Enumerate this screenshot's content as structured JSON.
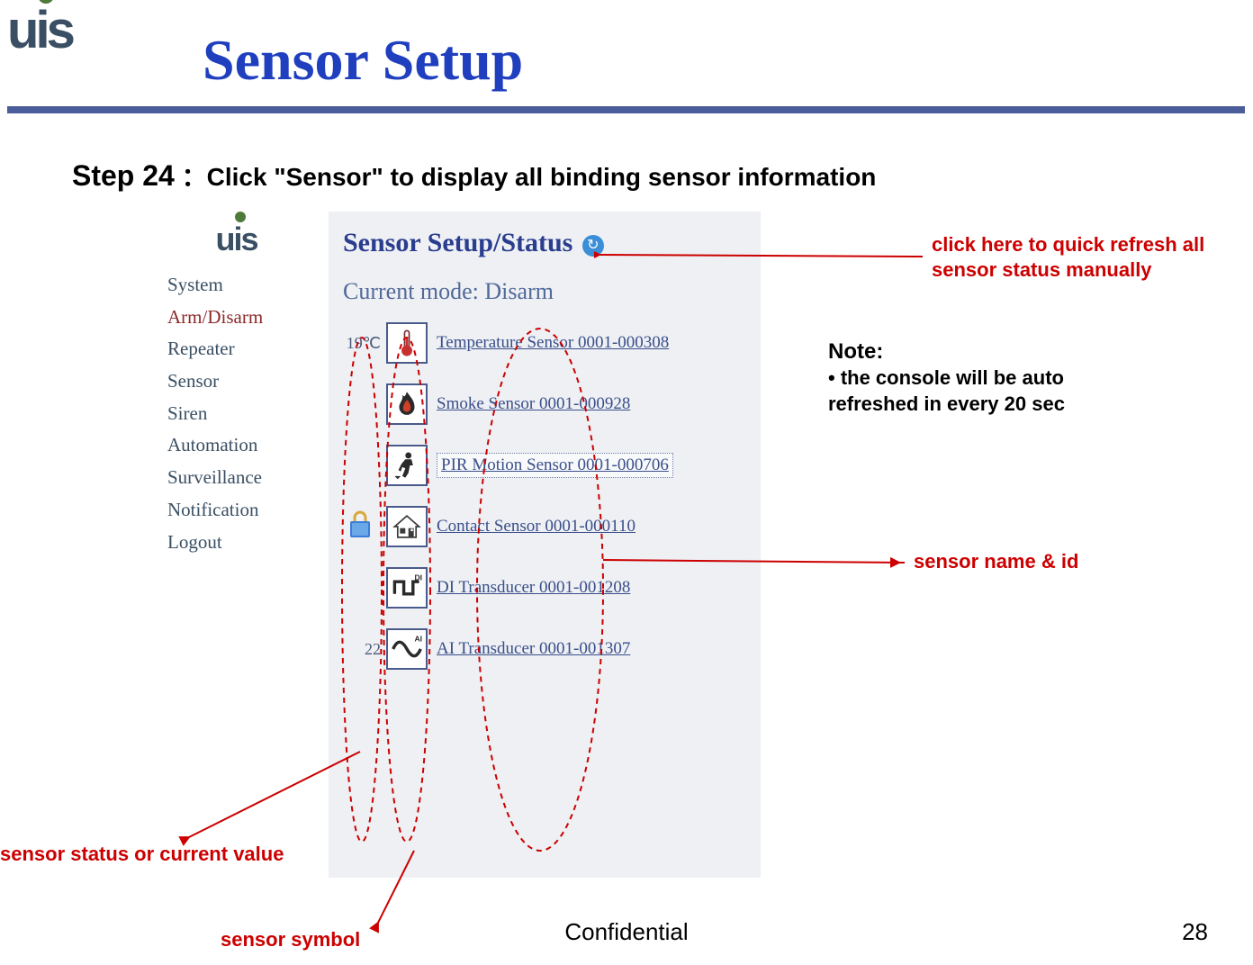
{
  "page_title": "Sensor Setup",
  "step": {
    "label": "Step 24",
    "sep": "：",
    "text": "Click \"Sensor\" to display all binding sensor information"
  },
  "footer": {
    "confidential": "Confidential",
    "page": "28"
  },
  "callouts": {
    "refresh": "click here to quick refresh all sensor status manually",
    "note_label": "Note:",
    "note_text": "• the console will be auto\n  refreshed in every 20 sec",
    "name_id": "sensor name & id",
    "status_value": "sensor status or current value",
    "symbol": "sensor symbol"
  },
  "screenshot": {
    "nav": [
      {
        "label": "System",
        "active": false
      },
      {
        "label": "Arm/Disarm",
        "active": true
      },
      {
        "label": "Repeater",
        "active": false
      },
      {
        "label": "Sensor",
        "active": false
      },
      {
        "label": "Siren",
        "active": false
      },
      {
        "label": "Automation",
        "active": false
      },
      {
        "label": "Surveillance",
        "active": false
      },
      {
        "label": "Notification",
        "active": false
      },
      {
        "label": "Logout",
        "active": false
      }
    ],
    "heading": "Sensor Setup/Status",
    "mode": "Current mode: Disarm",
    "sensors": [
      {
        "value": "19℃",
        "icon": "thermometer-icon",
        "link": "Temperature Sensor 0001-000308",
        "prefix": ""
      },
      {
        "value": "",
        "icon": "flame-icon",
        "link": "Smoke Sensor 0001-000928",
        "prefix": ""
      },
      {
        "value": "",
        "icon": "motion-icon",
        "link": "PIR Motion Sensor 0001-000706",
        "prefix": "",
        "boxed": true
      },
      {
        "value": "",
        "icon": "house-icon",
        "link": "Contact Sensor 0001-000110",
        "prefix": "lock"
      },
      {
        "value": "",
        "icon": "square-wave-icon",
        "link": "DI Transducer 0001-001208",
        "prefix": "",
        "badge": "DI"
      },
      {
        "value": "22",
        "icon": "sine-wave-icon",
        "link": "AI Transducer 0001-001307",
        "prefix": "",
        "badge": "AI"
      }
    ]
  }
}
